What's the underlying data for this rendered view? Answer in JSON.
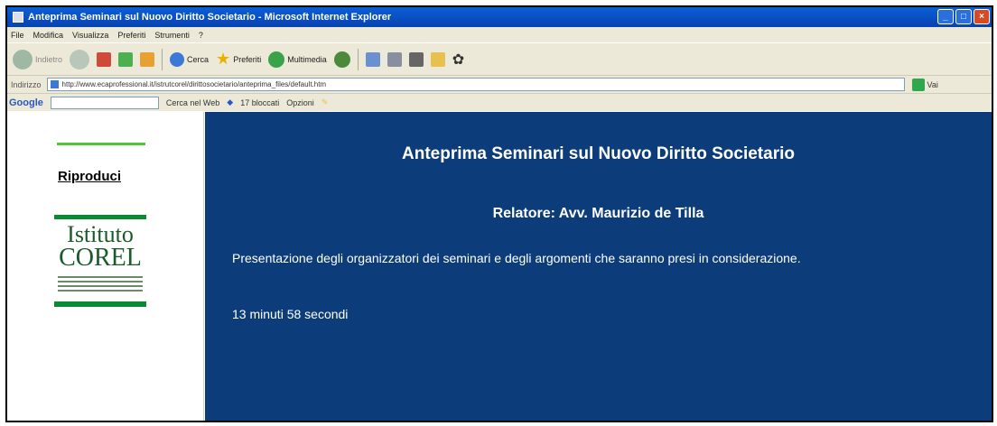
{
  "window": {
    "title": "Anteprima Seminari sul Nuovo Diritto Societario - Microsoft Internet Explorer"
  },
  "menu": [
    "File",
    "Modifica",
    "Visualizza",
    "Preferiti",
    "Strumenti",
    "?"
  ],
  "toolbar": {
    "back_label": "Indietro",
    "search_label": "Cerca",
    "favorites_label": "Preferiti",
    "multimedia_label": "Multimedia"
  },
  "address": {
    "label": "Indirizzo",
    "url": "http://www.ecaprofessional.it/istrutcorel/dirittosocietario/anteprima_files/default.htm",
    "go_label": "Vai"
  },
  "google": {
    "logo": "Google",
    "search_web_label": "Cerca nel Web",
    "blocked_label": "17 bloccati",
    "options_label": "Opzioni"
  },
  "sidebar": {
    "play_label": "Riproduci",
    "logo_line1": "Istituto",
    "logo_line2": "COREL"
  },
  "main": {
    "title": "Anteprima Seminari sul Nuovo Diritto Societario",
    "speaker": "Relatore: Avv. Maurizio de Tilla",
    "description": "Presentazione degli organizzatori dei seminari e degli argomenti che saranno presi in considerazione.",
    "duration": "13 minuti 58 secondi"
  },
  "colors": {
    "main_background": "#0c3d7a",
    "titlebar": "#0a5fd8",
    "accent_green": "#56c23a"
  }
}
